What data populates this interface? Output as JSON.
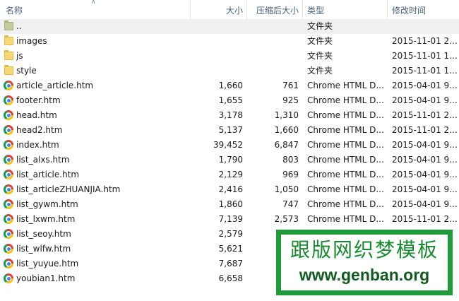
{
  "columns": {
    "name": "名称",
    "size": "大小",
    "compressed": "压缩后大小",
    "type": "类型",
    "modified": "修改时间"
  },
  "rows": [
    {
      "name": "..",
      "size": "",
      "compressed": "",
      "type": "文件夹",
      "date": "",
      "icon": "folder-up-icon"
    },
    {
      "name": "images",
      "size": "",
      "compressed": "",
      "type": "文件夹",
      "date": "2015-11-01 2...",
      "icon": "folder-icon"
    },
    {
      "name": "js",
      "size": "",
      "compressed": "",
      "type": "文件夹",
      "date": "2015-11-01 1...",
      "icon": "folder-icon"
    },
    {
      "name": "style",
      "size": "",
      "compressed": "",
      "type": "文件夹",
      "date": "2015-11-01 1...",
      "icon": "folder-icon"
    },
    {
      "name": "article_article.htm",
      "size": "1,660",
      "compressed": "761",
      "type": "Chrome HTML D...",
      "date": "2015-04-01 9...",
      "icon": "chrome-file-icon"
    },
    {
      "name": "footer.htm",
      "size": "1,655",
      "compressed": "925",
      "type": "Chrome HTML D...",
      "date": "2015-04-01 9...",
      "icon": "chrome-file-icon"
    },
    {
      "name": "head.htm",
      "size": "3,178",
      "compressed": "1,310",
      "type": "Chrome HTML D...",
      "date": "2015-11-01 2...",
      "icon": "chrome-file-icon"
    },
    {
      "name": "head2.htm",
      "size": "5,137",
      "compressed": "1,660",
      "type": "Chrome HTML D...",
      "date": "2015-11-01 2...",
      "icon": "chrome-file-icon"
    },
    {
      "name": "index.htm",
      "size": "39,452",
      "compressed": "6,847",
      "type": "Chrome HTML D...",
      "date": "2015-04-01 9...",
      "icon": "chrome-file-icon"
    },
    {
      "name": "list_alxs.htm",
      "size": "1,790",
      "compressed": "803",
      "type": "Chrome HTML D...",
      "date": "2015-04-01 9...",
      "icon": "chrome-file-icon"
    },
    {
      "name": "list_article.htm",
      "size": "2,129",
      "compressed": "969",
      "type": "Chrome HTML D...",
      "date": "2015-04-01 9...",
      "icon": "chrome-file-icon"
    },
    {
      "name": "list_articleZHUANJIA.htm",
      "size": "2,416",
      "compressed": "1,050",
      "type": "Chrome HTML D...",
      "date": "2015-04-01 9...",
      "icon": "chrome-file-icon"
    },
    {
      "name": "list_gywm.htm",
      "size": "1,860",
      "compressed": "747",
      "type": "Chrome HTML D...",
      "date": "2015-04-01 9...",
      "icon": "chrome-file-icon"
    },
    {
      "name": "list_lxwm.htm",
      "size": "7,139",
      "compressed": "2,573",
      "type": "Chrome HTML D...",
      "date": "2015-11-01 2...",
      "icon": "chrome-file-icon"
    },
    {
      "name": "list_seoy.htm",
      "size": "2,579",
      "compressed": "",
      "type": "",
      "date": "",
      "icon": "chrome-file-icon"
    },
    {
      "name": "list_wlfw.htm",
      "size": "5,621",
      "compressed": "",
      "type": "",
      "date": "",
      "icon": "chrome-file-icon"
    },
    {
      "name": "list_yuyue.htm",
      "size": "7,687",
      "compressed": "",
      "type": "",
      "date": "",
      "icon": "chrome-file-icon"
    },
    {
      "name": "youbian1.htm",
      "size": "6,658",
      "compressed": "",
      "type": "",
      "date": "",
      "icon": "chrome-file-icon"
    }
  ],
  "watermark": {
    "title": "跟版网织梦模板",
    "url": "www.genban.org"
  },
  "colors": {
    "header_text": "#4c607a",
    "selected_row": "#f0f0f0",
    "watermark_green": "#209b3a"
  }
}
